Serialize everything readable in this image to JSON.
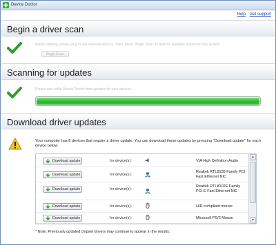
{
  "window": {
    "title": "Device Doctor",
    "app_icon": "green-plus-icon"
  },
  "toplinks": {
    "help": "Help",
    "support": "Get support"
  },
  "sections": {
    "scan": {
      "title": "Begin a driver scan",
      "text": "Before starting, please plug in any external devices. Then, press \"Begin Scan\" to look for available drivers for this system.",
      "button": "Begin Scan",
      "icon": "green-check-icon"
    },
    "scanning": {
      "title": "Scanning for updates",
      "text": "Please wait while Device Doctor finds updates for your devices...",
      "progress": 1.0,
      "icon": "green-check-icon"
    },
    "download": {
      "title": "Download driver updates",
      "info": "Your computer has 8 devices that require a driver update. You can download these updates by pressing \"Download update\" for each device below.",
      "icon": "warning-icon",
      "note": "* Note: Previously updated chipset drivers may continue to appear in the results."
    }
  },
  "devices": [
    {
      "button": "Download update",
      "for": "for device(s):",
      "icon": "speaker-icon",
      "name": "VIA High Definition Audio"
    },
    {
      "button": "Download update",
      "for": "for device(s):",
      "icon": "network-icon",
      "name": "Realtek RTL8139 Family PCI Fast Ethernet NIC"
    },
    {
      "button": "Download update",
      "for": "for device(s):",
      "icon": "network-icon",
      "name": "Realtek RTL8102E Family PCI-E Fast Ethernet NIC"
    },
    {
      "button": "Download update",
      "for": "for device(s):",
      "icon": "mouse-icon",
      "name": "HID-compliant mouse"
    },
    {
      "button": "Download update",
      "for": "for device(s):",
      "icon": "mouse-icon",
      "name": "Microsoft PS/2 Mouse"
    }
  ],
  "colors": {
    "progress": "#2fb52f",
    "check": "#2e9e2e",
    "warning": "#f2c12e",
    "link": "#2244aa"
  }
}
